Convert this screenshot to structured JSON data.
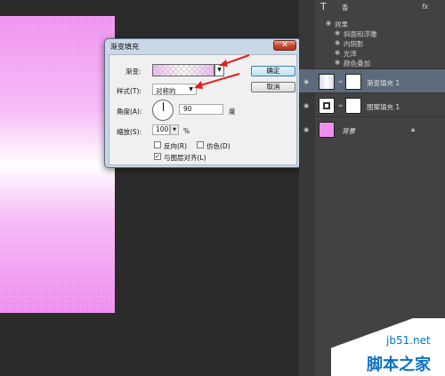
{
  "dialog": {
    "title": "渐变填充",
    "close": "✕",
    "gradient_label": "渐变:",
    "style_label": "样式(T):",
    "style_value": "对称的",
    "angle_label": "角度(A):",
    "angle_value": "90",
    "angle_unit": "度",
    "scale_label": "缩放(S):",
    "scale_value": "100",
    "scale_unit": "%",
    "reverse_label": "反向(R)",
    "dither_label": "仿色(D)",
    "align_label": "与图层对齐(L)",
    "ok_label": "确定",
    "cancel_label": "取消"
  },
  "panel": {
    "text_layer_label": "香",
    "fx_label": "fx",
    "effects_header": "效果",
    "effects": [
      "斜面和浮雕",
      "内阴影",
      "光泽",
      "颜色叠加"
    ],
    "layers": [
      {
        "name": "渐变填充 1"
      },
      {
        "name": "图案填充 1"
      },
      {
        "name": "背景"
      }
    ]
  },
  "watermark": {
    "domain": "jb51.net",
    "name": "脚本之家"
  },
  "colors": {
    "canvas_pink": "#f08ef0",
    "panel_bg": "#424242",
    "selected_layer": "#5c6a7b",
    "arrow_red": "#e0201c"
  }
}
